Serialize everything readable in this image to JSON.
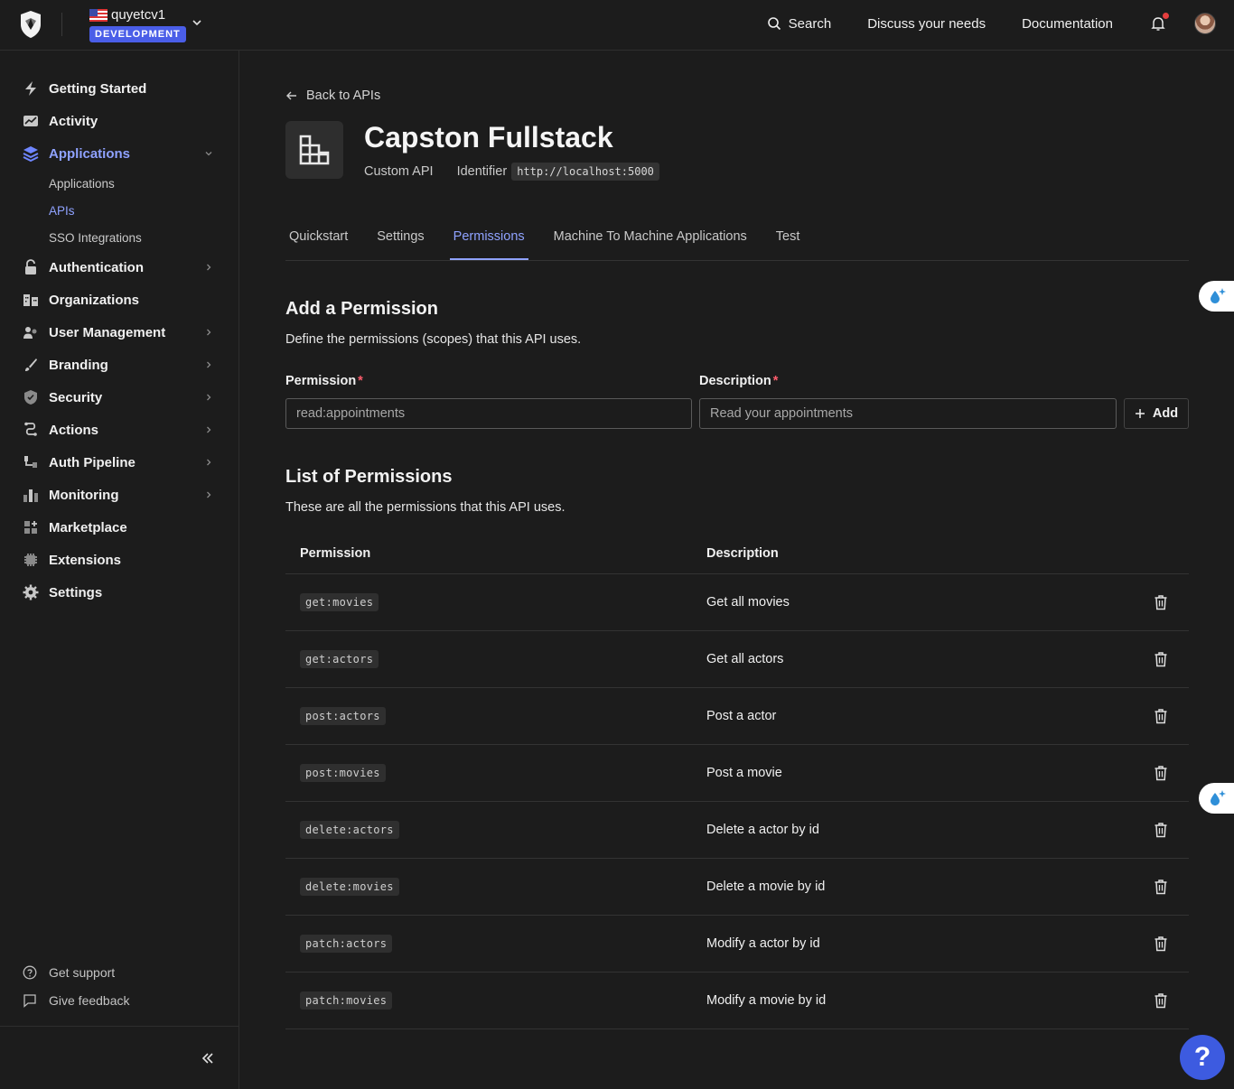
{
  "tenant": {
    "name": "quyetcv1",
    "environment": "DEVELOPMENT"
  },
  "topnav": {
    "search": "Search",
    "discuss": "Discuss your needs",
    "docs": "Documentation"
  },
  "sidebar": {
    "items": [
      {
        "label": "Getting Started",
        "icon": "bolt-icon"
      },
      {
        "label": "Activity",
        "icon": "activity-icon"
      },
      {
        "label": "Applications",
        "icon": "layers-icon"
      },
      {
        "label": "Authentication",
        "icon": "lock-icon"
      },
      {
        "label": "Organizations",
        "icon": "building-icon"
      },
      {
        "label": "User Management",
        "icon": "users-icon"
      },
      {
        "label": "Branding",
        "icon": "brush-icon"
      },
      {
        "label": "Security",
        "icon": "shield-icon"
      },
      {
        "label": "Actions",
        "icon": "actions-icon"
      },
      {
        "label": "Auth Pipeline",
        "icon": "pipeline-icon"
      },
      {
        "label": "Monitoring",
        "icon": "chart-icon"
      },
      {
        "label": "Marketplace",
        "icon": "marketplace-icon"
      },
      {
        "label": "Extensions",
        "icon": "chip-icon"
      },
      {
        "label": "Settings",
        "icon": "gear-icon"
      }
    ],
    "subitems": [
      "Applications",
      "APIs",
      "SSO Integrations"
    ],
    "support": "Get support",
    "feedback": "Give feedback"
  },
  "page": {
    "back": "Back to APIs",
    "title": "Capston Fullstack",
    "type": "Custom API",
    "identifier_label": "Identifier",
    "identifier": "http://localhost:5000",
    "tabs": [
      "Quickstart",
      "Settings",
      "Permissions",
      "Machine To Machine Applications",
      "Test"
    ]
  },
  "add_permission": {
    "title": "Add a Permission",
    "desc": "Define the permissions (scopes) that this API uses.",
    "permission_label": "Permission",
    "description_label": "Description",
    "permission_placeholder": "read:appointments",
    "description_placeholder": "Read your appointments",
    "add_label": "Add"
  },
  "list": {
    "title": "List of Permissions",
    "desc": "These are all the permissions that this API uses.",
    "col_permission": "Permission",
    "col_description": "Description",
    "rows": [
      {
        "scope": "get:movies",
        "description": "Get all movies"
      },
      {
        "scope": "get:actors",
        "description": "Get all actors"
      },
      {
        "scope": "post:actors",
        "description": "Post a actor"
      },
      {
        "scope": "post:movies",
        "description": "Post a movie"
      },
      {
        "scope": "delete:actors",
        "description": "Delete a actor by id"
      },
      {
        "scope": "delete:movies",
        "description": "Delete a movie by id"
      },
      {
        "scope": "patch:actors",
        "description": "Modify a actor by id"
      },
      {
        "scope": "patch:movies",
        "description": "Modify a movie by id"
      }
    ]
  },
  "help": "?",
  "colors": {
    "accent": "#8fa2ff",
    "badge": "#4a5ee8",
    "help": "#3d5be0",
    "required": "#ff5c6c"
  }
}
